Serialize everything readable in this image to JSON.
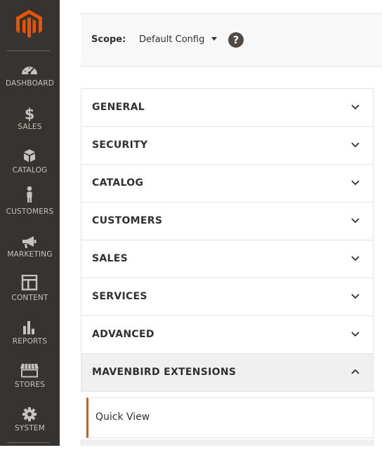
{
  "colors": {
    "sidebar_bg": "#373330",
    "accent": "#eb5202",
    "text": "#303030",
    "sidebar_text": "#c6c2be"
  },
  "sidebar": {
    "items": [
      {
        "label": "DASHBOARD",
        "icon": "dashboard-gauge-icon"
      },
      {
        "label": "SALES",
        "icon": "dollar-icon"
      },
      {
        "label": "CATALOG",
        "icon": "box-icon"
      },
      {
        "label": "CUSTOMERS",
        "icon": "person-icon"
      },
      {
        "label": "MARKETING",
        "icon": "megaphone-icon"
      },
      {
        "label": "CONTENT",
        "icon": "layout-icon"
      },
      {
        "label": "REPORTS",
        "icon": "bar-chart-icon"
      },
      {
        "label": "STORES",
        "icon": "storefront-icon"
      },
      {
        "label": "SYSTEM",
        "icon": "gear-icon"
      }
    ]
  },
  "scope": {
    "label": "Scope:",
    "value": "Default Config",
    "help": "?"
  },
  "sections": [
    {
      "label": "GENERAL",
      "expanded": false
    },
    {
      "label": "SECURITY",
      "expanded": false
    },
    {
      "label": "CATALOG",
      "expanded": false
    },
    {
      "label": "CUSTOMERS",
      "expanded": false
    },
    {
      "label": "SALES",
      "expanded": false
    },
    {
      "label": "SERVICES",
      "expanded": false
    },
    {
      "label": "ADVANCED",
      "expanded": false
    },
    {
      "label": "MAVENBIRD EXTENSIONS",
      "expanded": true
    }
  ],
  "subitems": [
    {
      "label": "Quick View"
    }
  ]
}
